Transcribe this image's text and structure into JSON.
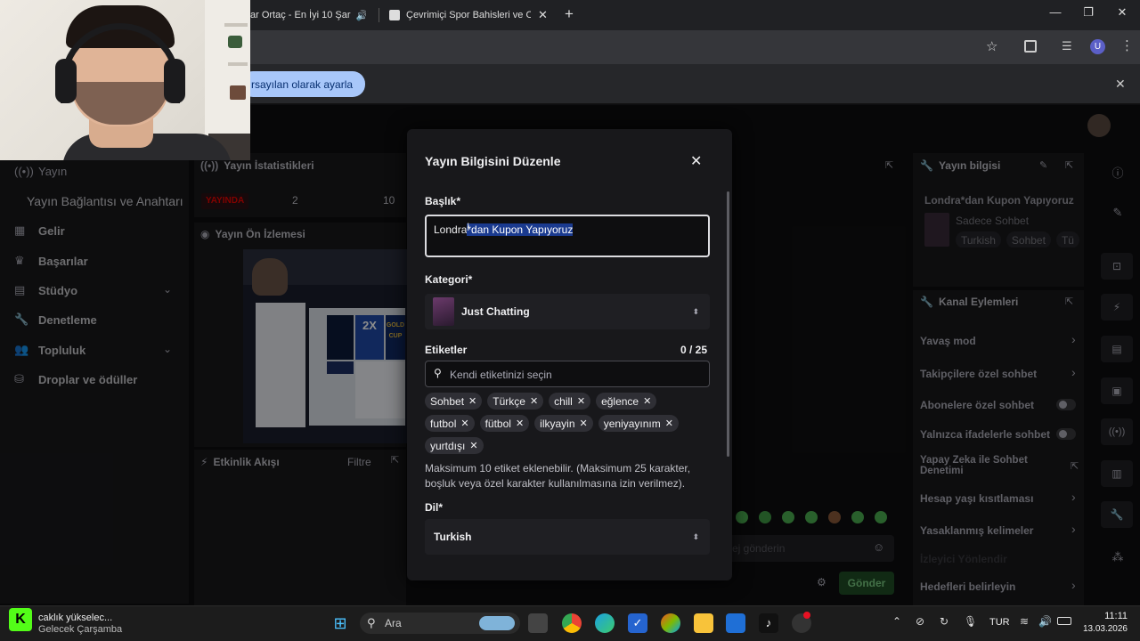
{
  "browser": {
    "tabs": [
      {
        "label": "ar Ortaç - En İyi 10 Şar",
        "audio_icon": "speaker-icon"
      },
      {
        "label": "Çevrimiçi Spor Bahisleri ve Oran"
      }
    ],
    "new_tab": "+",
    "profile_initial": "U",
    "infobar_button": "rsayılan olarak ayarla"
  },
  "sidebar": {
    "items": [
      {
        "label": "Yayın",
        "icon": "broadcast-icon"
      },
      {
        "label": "Yayın Bağlantısı ve Anahtarı",
        "icon": ""
      },
      {
        "label": "Gelir",
        "icon": "revenue-icon"
      },
      {
        "label": "Başarılar",
        "icon": "trophy-icon"
      },
      {
        "label": "Stüdyo",
        "icon": "studio-icon"
      },
      {
        "label": "Denetleme",
        "icon": "wrench-icon"
      },
      {
        "label": "Topluluk",
        "icon": "community-icon"
      },
      {
        "label": "Droplar ve ödüller",
        "icon": "drops-icon"
      }
    ]
  },
  "stats": {
    "title": "Yayın İstatistikleri",
    "live_badge": "YAYINDA",
    "value_1": "2",
    "value_2": "10"
  },
  "preview": {
    "title": "Yayın Ön İzlemesi"
  },
  "activity": {
    "title": "Etkinlik Akışı",
    "filter": "Filtre"
  },
  "chat": {
    "placeholder": "ej gönderin",
    "send": "Gönder",
    "emote_color": "#4caf50"
  },
  "modal": {
    "title": "Yayın Bilgisini Düzenle",
    "title_label": "Başlık*",
    "title_value_plain": "Londra",
    "title_value_selected": "*dan Kupon Yapıyoruz",
    "category_label": "Kategori*",
    "category_value": "Just Chatting",
    "tags_label": "Etiketler",
    "tags_count": "0 / 25",
    "tags_placeholder": "Kendi etiketinizi seçin",
    "tags": [
      "Sohbet",
      "Türkçe",
      "chill",
      "eğlence",
      "futbol",
      "fütbol",
      "ilkyayin",
      "yeniyayınım",
      "yurtdışı"
    ],
    "tags_help": "Maksimum 10 etiket eklenebilir. (Maksimum 25 karakter, boşluk veya özel karakter kullanılmasına izin verilmez).",
    "lang_label": "Dil*",
    "lang_value": "Turkish",
    "selection_color": "#1a3a8f"
  },
  "stream_info": {
    "title": "Yayın bilgisi",
    "stream_title": "Londra*dan Kupon Yapıyoruz",
    "category": "Sadece Sohbet",
    "tags": [
      "Turkish",
      "Sohbet",
      "Tü"
    ]
  },
  "channel_actions": {
    "title": "Kanal Eylemleri",
    "items": [
      {
        "label": "Yavaş mod",
        "control": "arrow"
      },
      {
        "label": "Takipçilere özel sohbet",
        "control": "arrow"
      },
      {
        "label": "Abonelere özel sohbet",
        "control": "toggle"
      },
      {
        "label": "Yalnızca ifadelerle sohbet",
        "control": "toggle"
      },
      {
        "label": "Yapay Zeka ile Sohbet Denetimi",
        "control": "external"
      },
      {
        "label": "Hesap yaşı kısıtlaması",
        "control": "arrow"
      },
      {
        "label": "Yasaklanmış kelimeler",
        "control": "arrow"
      },
      {
        "label": "İzleyici Yönlendir",
        "control": "none"
      },
      {
        "label": "Hedefleri belirleyin",
        "control": "arrow"
      }
    ]
  },
  "taskbar": {
    "news_line1": "caklık yükselec...",
    "news_line2": "Gelecek Çarşamba",
    "search": "Ara",
    "lang": "TUR",
    "time": "11:11",
    "date": "13.03.2026"
  }
}
